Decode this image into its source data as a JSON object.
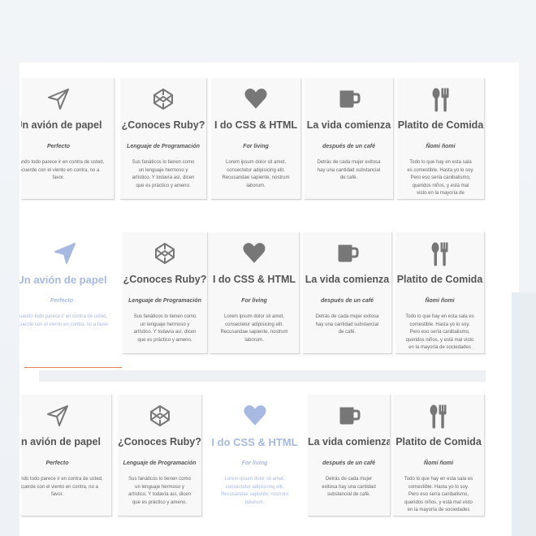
{
  "cards": [
    {
      "key": "plane",
      "title": "Un avión de papel",
      "subtitle": "Perfecto",
      "description": "Cuando todo parece ir en contra de usted, recuerde con el viento en contra, no a favor.",
      "icon": "paper-plane-icon"
    },
    {
      "key": "ruby",
      "title": "¿Conoces Ruby?",
      "subtitle": "Lenguaje de Programación",
      "description": "Sus fanáticos lo tienen como un lenguaje hermoso y artístico. Y todavía así, dicen que es práctico y ameno.",
      "icon": "codepen-icon"
    },
    {
      "key": "css",
      "title": "I do CSS & HTML",
      "subtitle": "For living",
      "description": "Lorem ipsum dolor sit amet, consectetur adipisicing elit. Recusandae sapiente, nostrum laborum.",
      "icon": "heart-icon"
    },
    {
      "key": "vida",
      "title": "La vida comienza",
      "subtitle": "después de un café",
      "description": "Detrás de cada mujer exitosa hay una cantidad substancial de café.",
      "icon": "coffee-mug-icon"
    },
    {
      "key": "platito",
      "title": "Platito de Comida",
      "subtitle": "Ñomi ñomi",
      "description": "Todo lo que hay en esta sala es comestible. Hasta yo lo soy. Pero eso sería canibalismo, queridos niños, y está mal visto en la mayoría de sociedades",
      "icon": "spoon-fork-icon"
    }
  ],
  "colors": {
    "highlight": "#a7b9e0",
    "text": "#555555",
    "accent_line": "#e0825c"
  }
}
